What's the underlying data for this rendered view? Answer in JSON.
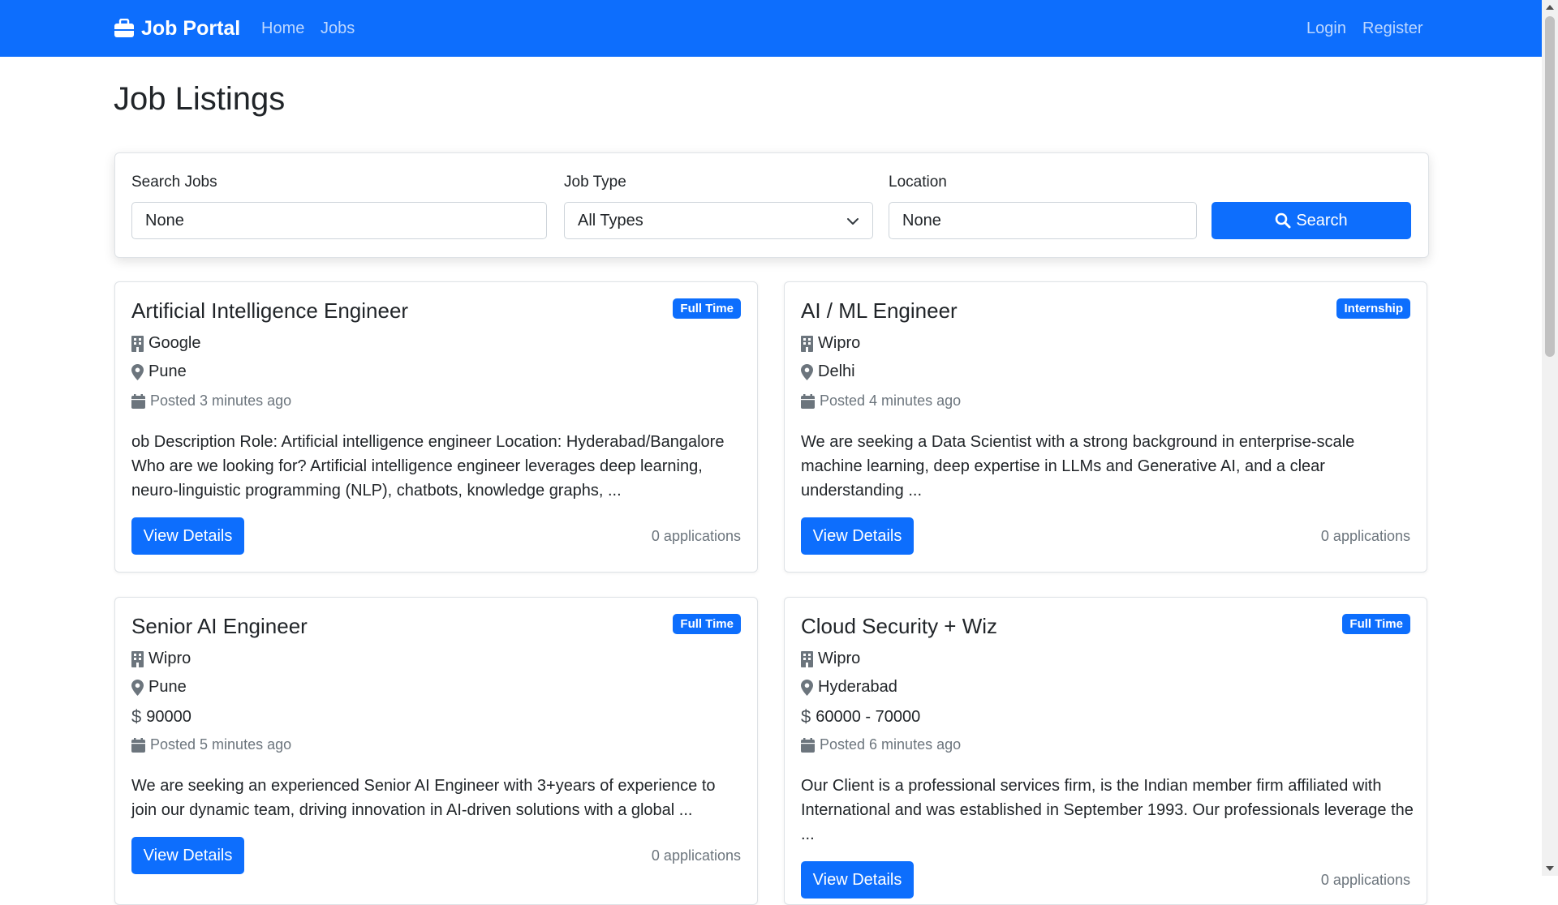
{
  "nav": {
    "brand": "Job Portal",
    "links": [
      "Home",
      "Jobs"
    ],
    "login": "Login",
    "register": "Register",
    "brand_icon": "briefcase-icon"
  },
  "page": {
    "title": "Job Listings"
  },
  "search": {
    "search_label": "Search Jobs",
    "search_value": "None",
    "type_label": "Job Type",
    "type_value": "All Types",
    "location_label": "Location",
    "location_value": "None",
    "button_label": "Search"
  },
  "jobs": [
    {
      "title": "Artificial Intelligence Engineer",
      "badge": "Full Time",
      "company": "Google",
      "location": "Pune",
      "salary": "",
      "posted": "Posted 3 minutes ago",
      "description": "ob Description Role: Artificial intelligence engineer Location: Hyderabad/Bangalore Who are we looking for? Artificial intelligence engineer leverages deep learning, neuro-linguistic programming (NLP), chatbots, knowledge graphs, ...",
      "button": "View Details",
      "applications": "0 applications"
    },
    {
      "title": "AI / ML Engineer",
      "badge": "Internship",
      "company": "Wipro",
      "location": "Delhi",
      "salary": "",
      "posted": "Posted 4 minutes ago",
      "description": "We are seeking a Data Scientist with a strong background in enterprise-scale machine learning, deep expertise in LLMs and Generative AI, and a clear understanding ...",
      "button": "View Details",
      "applications": "0 applications"
    },
    {
      "title": "Senior AI Engineer",
      "badge": "Full Time",
      "company": "Wipro",
      "location": "Pune",
      "salary": "90000",
      "posted": "Posted 5 minutes ago",
      "description": "We are seeking an experienced Senior AI Engineer with 3+years of experience to join our dynamic team, driving innovation in AI-driven solutions with a global ...",
      "button": "View Details",
      "applications": "0 applications"
    },
    {
      "title": "Cloud Security + Wiz",
      "badge": "Full Time",
      "company": "Wipro",
      "location": "Hyderabad",
      "salary": "60000 - 70000",
      "posted": "Posted 6 minutes ago",
      "description": "Our Client is a professional services firm, is the Indian member firm affiliated with International and was established in September 1993. Our professionals leverage the ...",
      "button": "View Details",
      "applications": "0 applications"
    }
  ],
  "colors": {
    "primary": "#0d6efd",
    "muted": "#6c757d",
    "text": "#212529"
  }
}
